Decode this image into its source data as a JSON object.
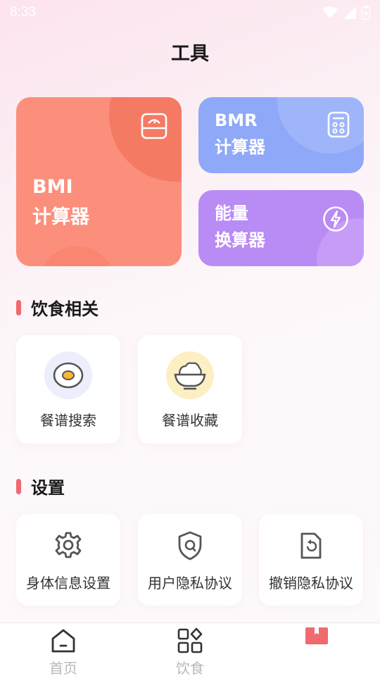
{
  "status": {
    "time": "8:33"
  },
  "page_title": "工具",
  "cards": {
    "bmi": {
      "line1": "BMI",
      "line2": "计算器",
      "icon": "scale-icon"
    },
    "bmr": {
      "line1": "BMR",
      "line2": "计算器",
      "icon": "calculator-icon"
    },
    "energy": {
      "line1": "能量",
      "line2": "换算器",
      "icon": "lightning-icon"
    }
  },
  "diet_section": {
    "title": "饮食相关",
    "tiles": [
      {
        "label": "餐谱搜索",
        "icon": "egg-icon"
      },
      {
        "label": "餐谱收藏",
        "icon": "rice-bowl-icon"
      }
    ]
  },
  "settings_section": {
    "title": "设置",
    "tiles": [
      {
        "label": "身体信息设置",
        "icon": "gear-icon"
      },
      {
        "label": "用户隐私协议",
        "icon": "shield-icon"
      },
      {
        "label": "撤销隐私协议",
        "icon": "revoke-document-icon"
      }
    ]
  },
  "bottom_nav": {
    "items": [
      {
        "label": "首页",
        "icon": "home-icon"
      },
      {
        "label": "饮食",
        "icon": "grid-icon"
      },
      {
        "label": "",
        "icon": "bookmark-icon"
      }
    ],
    "active_color": "#f06a6f"
  }
}
